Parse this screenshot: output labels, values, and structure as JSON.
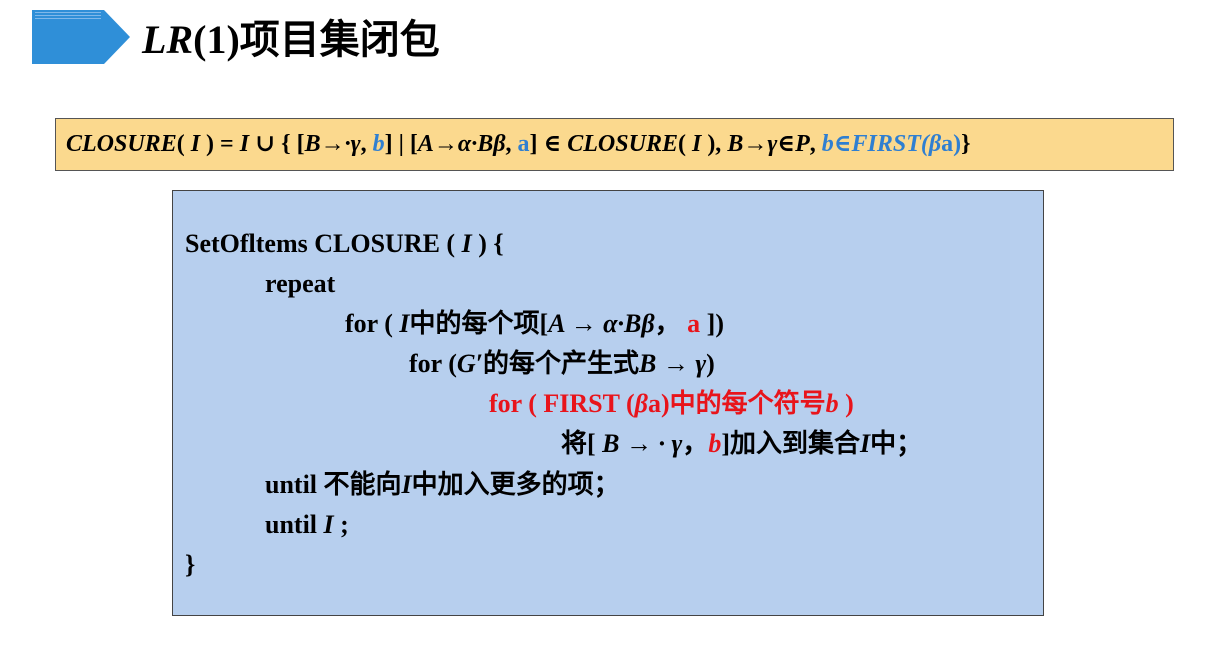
{
  "slide": {
    "title": {
      "lr": "LR",
      "paren": "(1)",
      "rest": "项目集闭包"
    },
    "formula": {
      "closure1": "CLOSURE",
      "open1": "( ",
      "i1": "I",
      "close1": " ) = ",
      "i2": "I",
      "union": " ∪ { [",
      "item1": "B→·γ",
      "comma1": ", ",
      "b1": "b",
      "mid": "] | [",
      "item2": "A→α·Bβ",
      "comma2": ", ",
      "a1": "a",
      "in1": "] ∈ ",
      "closure2": "CLOSURE",
      "open2": "( ",
      "i3": "I",
      "close2": " ), ",
      "prod": "B→γ∈P",
      "comma3": ", ",
      "b2": "b",
      "in2": "∈",
      "first": "FIRST(β",
      "a2": "a)",
      "end": "}"
    },
    "code": {
      "l1_a": "SetOfltems CLOSURE ( ",
      "l1_i": "I",
      "l1_b": " ) {",
      "l2": "repeat",
      "l3_a": "for ( ",
      "l3_i": "I",
      "l3_b": "中的每个项[",
      "l3_item": "A → α·Bβ",
      "l3_c": "，",
      "l3_a2": " a",
      "l3_d": " ])",
      "l4_a": "for (",
      "l4_g": "G′",
      "l4_b": "的每个产生式",
      "l4_prod": "B → γ",
      "l4_c": ")",
      "l5_a": "for ( FIRST (",
      "l5_beta": "β",
      "l5_b": "a)中的每个符号",
      "l5_bb": "b",
      "l5_c": " )",
      "l6_a": "将[ ",
      "l6_item": "B → · γ",
      "l6_b": "，",
      "l6_bb": "b",
      "l6_c": "]加入到集合",
      "l6_i": "I",
      "l6_d": "中；",
      "l7_a": "until 不能向",
      "l7_i": "I",
      "l7_b": "中加入更多的项；",
      "l8_a": "until ",
      "l8_i": "I",
      "l8_b": " ;",
      "l9": "}"
    }
  },
  "colors": {
    "title_bar": "#2f8fd8",
    "formula_bg": "#fbd98e",
    "code_bg": "#b7cfee",
    "blue_text": "#2f7fd1",
    "red_text": "#e8141b"
  }
}
